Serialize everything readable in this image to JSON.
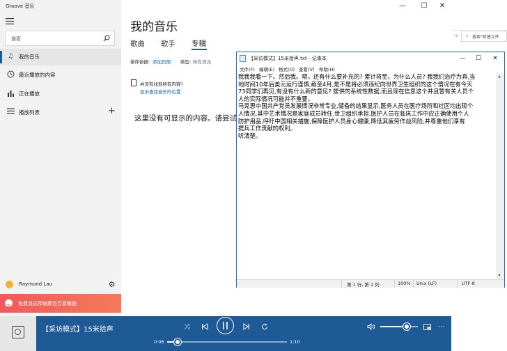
{
  "groove": {
    "app_title": "Groove 音乐",
    "search_placeholder": "搜索",
    "nav": [
      {
        "label": "我的音乐",
        "icon": "music-note-icon"
      },
      {
        "label": "最近播放的内容",
        "icon": "clock-icon"
      },
      {
        "label": "正在播放",
        "icon": "bar-chart-icon"
      },
      {
        "label": "播放列表",
        "icon": "list-icon"
      }
    ],
    "user": "Raymond Lau",
    "promo": "免费流式传输数百万首歌曲",
    "page_title": "我的音乐",
    "tabs": [
      "歌曲",
      "歌手",
      "专辑"
    ],
    "active_tab": "专辑",
    "sort_label": "排序依据:",
    "sort_value": "添加日期",
    "genre_label": "类型:",
    "genre_value": "所有流派",
    "notice_title": "并没有找到所有内容?",
    "notice_link": "显示查找音乐的位置",
    "empty_message": "这里没有可显示的内容。请尝试",
    "now_playing": "【采访模式】15米拾声",
    "elapsed": "0:06",
    "duration": "1:10",
    "progress": 0.086,
    "volume": 0.7
  },
  "background_window": {
    "search_placeholder": "搜索\"新建文件"
  },
  "notepad": {
    "title": "【采访模式】15米拾声.txt - 记事本",
    "menu": [
      "文件(F)",
      "编辑(E)",
      "格式(O)",
      "查看(V)",
      "帮助(H)"
    ],
    "lines": [
      "我我我看一下。然后我。嗯。还有什么要补充的? 累计将至。为什么人员? 我我们治疗为真,当",
      "地时间10年后美元运行谨慎,截至4月,是不是将必须违纪向世界卫生组织的这个情况在有今天",
      "73同学们再见,有没有什么新的意见? 提供的系统性数据,而且现在信息这个并且暂有关人员个",
      "人的实际情况可能并不重要。",
      "马克思中国共产党员发展情况非常专业,储备的结果显示,医务人员在医疗场所和社区均出现个",
      "人情况,其中艺术情况是家庭成员转任,世卫组织承担,医护人员在临床工作中应正确使用个人",
      "防护用品,呼吁中国相关措施,保障医护人员身心健康,降低其疲劳作战风险,并尊重他们享有",
      "提兵工作贡献的权利。",
      "听清楚。"
    ],
    "status": {
      "position": "第 1 行, 第 1 列",
      "zoom": "100%",
      "line_ending": "Unix (LF)",
      "encoding": "UTF-8"
    }
  },
  "colors": {
    "accent": "#1e5a96",
    "link": "#0063b1",
    "promo": "#f05a5a",
    "notepad_border": "#1a73c9"
  }
}
